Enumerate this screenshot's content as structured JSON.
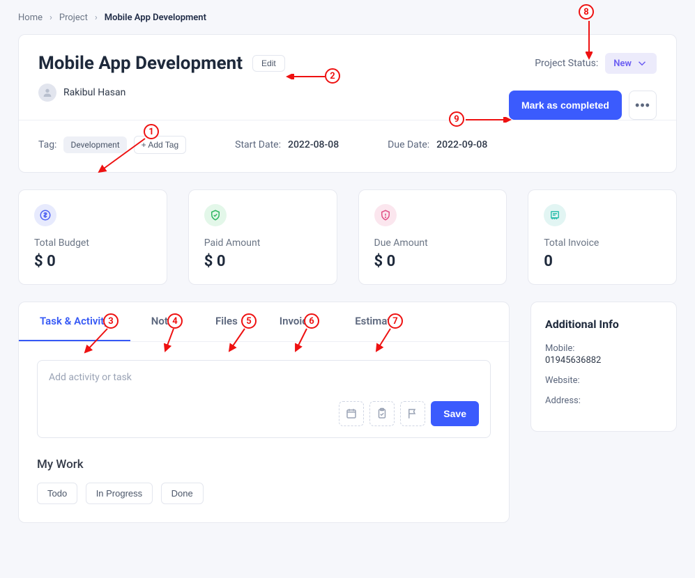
{
  "breadcrumb": {
    "home": "Home",
    "project": "Project",
    "current": "Mobile App Development"
  },
  "header": {
    "title": "Mobile App Development",
    "edit": "Edit",
    "status_label": "Project Status:",
    "status_value": "New",
    "author": "Rakibul Hasan",
    "complete": "Mark as completed"
  },
  "meta": {
    "tag_label": "Tag:",
    "tag_value": "Development",
    "add_tag": "+ Add Tag",
    "start_label": "Start Date:",
    "start_value": "2022-08-08",
    "due_label": "Due Date:",
    "due_value": "2022-09-08"
  },
  "stats": {
    "budget_label": "Total Budget",
    "budget_value": "$ 0",
    "paid_label": "Paid Amount",
    "paid_value": "$ 0",
    "due_label": "Due Amount",
    "due_value": "$ 0",
    "invoice_label": "Total Invoice",
    "invoice_value": "0"
  },
  "tabs": {
    "task": "Task & Activity",
    "note": "Note",
    "files": "Files",
    "invoice": "Invoice",
    "estimate": "Estimate"
  },
  "activity": {
    "placeholder": "Add activity or task",
    "save": "Save"
  },
  "mywork": {
    "title": "My Work",
    "todo": "Todo",
    "inprogress": "In Progress",
    "done": "Done"
  },
  "side": {
    "title": "Additional Info",
    "mobile_label": "Mobile:",
    "mobile_value": "01945636882",
    "website_label": "Website:",
    "address_label": "Address:"
  },
  "annot": {
    "a1": "1",
    "a2": "2",
    "a3": "3",
    "a4": "4",
    "a5": "5",
    "a6": "6",
    "a7": "7",
    "a8": "8",
    "a9": "9"
  }
}
